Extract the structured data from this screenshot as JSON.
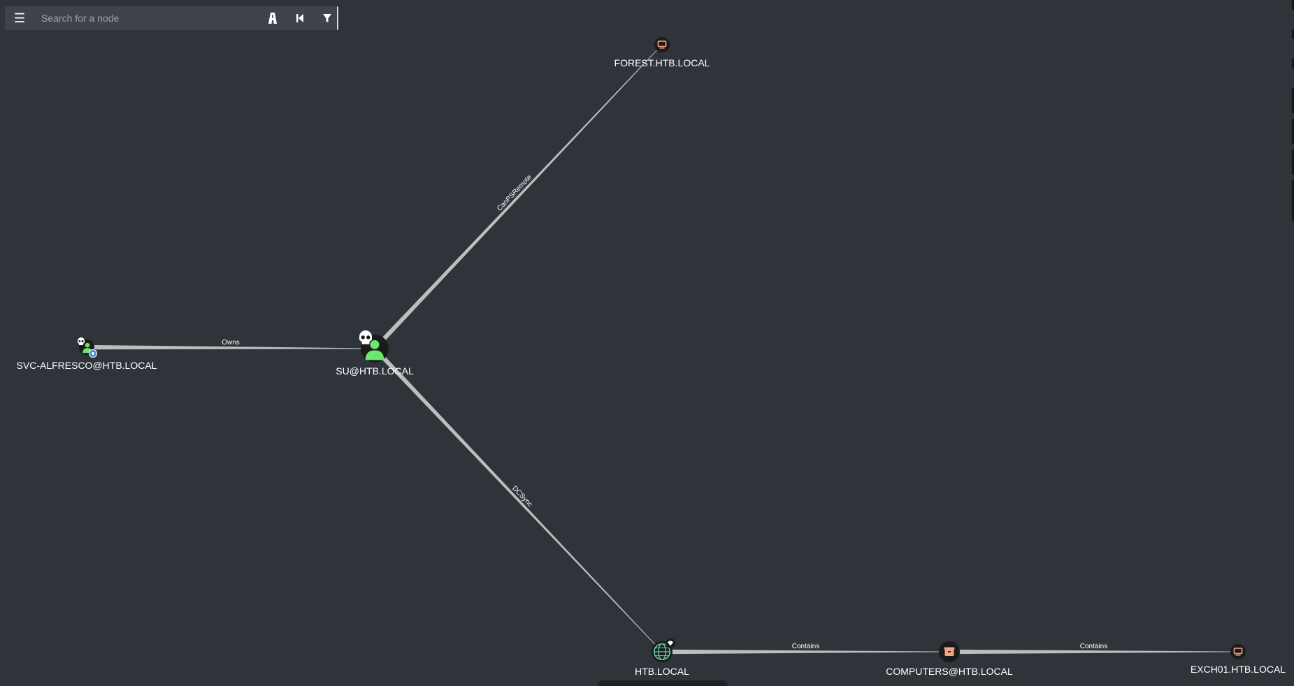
{
  "search": {
    "placeholder": "Search for a node"
  },
  "toolbar": {
    "menu_icon": "hamburger-icon",
    "pathfinding_icon": "road-icon",
    "back_icon": "step-back-icon",
    "filter_icon": "filter-icon"
  },
  "colors": {
    "background": "#2f333a",
    "user_node": "#6be86b",
    "domain_node": "#5fd4a6",
    "computer_node": "#e8967c",
    "ou_node": "#f0a580",
    "edge": "#bdbdbd",
    "text": "#ffffff"
  },
  "nodes": [
    {
      "id": "forest",
      "label": "FOREST.HTB.LOCAL",
      "type": "computer",
      "icon": "computer-icon"
    },
    {
      "id": "su",
      "label": "SU@HTB.LOCAL",
      "type": "user",
      "icon": "user-icon",
      "owned": true
    },
    {
      "id": "svc",
      "label": "SVC-ALFRESCO@HTB.LOCAL",
      "type": "group",
      "icon": "group-icon",
      "owned": true
    },
    {
      "id": "htb",
      "label": "HTB.LOCAL",
      "type": "domain",
      "icon": "globe-icon",
      "highvalue": true
    },
    {
      "id": "computers",
      "label": "COMPUTERS@HTB.LOCAL",
      "type": "ou",
      "icon": "box-icon"
    },
    {
      "id": "exch01",
      "label": "EXCH01.HTB.LOCAL",
      "type": "computer",
      "icon": "computer-icon"
    }
  ],
  "edges": [
    {
      "from": "svc",
      "to": "su",
      "label": "Owns"
    },
    {
      "from": "su",
      "to": "forest",
      "label": "CanPSRemote"
    },
    {
      "from": "su",
      "to": "htb",
      "label": "DCSync"
    },
    {
      "from": "htb",
      "to": "computers",
      "label": "Contains"
    },
    {
      "from": "computers",
      "to": "exch01",
      "label": "Contains"
    }
  ]
}
